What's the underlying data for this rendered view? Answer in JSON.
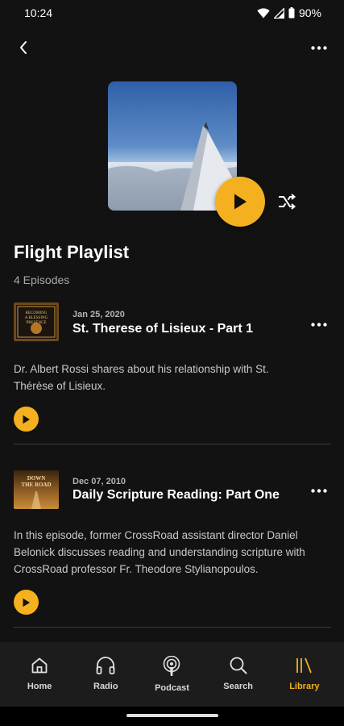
{
  "status_bar": {
    "time": "10:24",
    "battery": "90%"
  },
  "playlist": {
    "title": "Flight Playlist",
    "episode_count": "4 Episodes"
  },
  "episodes": [
    {
      "date": "Jan 25, 2020",
      "title": "St. Therese of Lisieux - Part 1",
      "description": "Dr. Albert Rossi shares about his relationship with St. Thérèse of Lisieux.",
      "thumb_text": "BECOMING A BLESSING PRESENCE"
    },
    {
      "date": "Dec 07, 2010",
      "title": "Daily Scripture Reading: Part One",
      "description": "In this episode, former CrossRoad assistant director Daniel Belonick discusses reading and understanding scripture with CrossRoad professor Fr. Theodore Stylianopoulos.",
      "thumb_text": "DOWN THE ROAD"
    }
  ],
  "nav": {
    "items": [
      {
        "label": "Home",
        "icon": "home-icon"
      },
      {
        "label": "Radio",
        "icon": "headphones-icon"
      },
      {
        "label": "Podcast",
        "icon": "podcast-icon"
      },
      {
        "label": "Search",
        "icon": "search-icon"
      },
      {
        "label": "Library",
        "icon": "library-icon",
        "active": true
      }
    ]
  },
  "colors": {
    "accent": "#F5B01F",
    "background": "#121212",
    "nav_background": "#1c1c1c"
  }
}
